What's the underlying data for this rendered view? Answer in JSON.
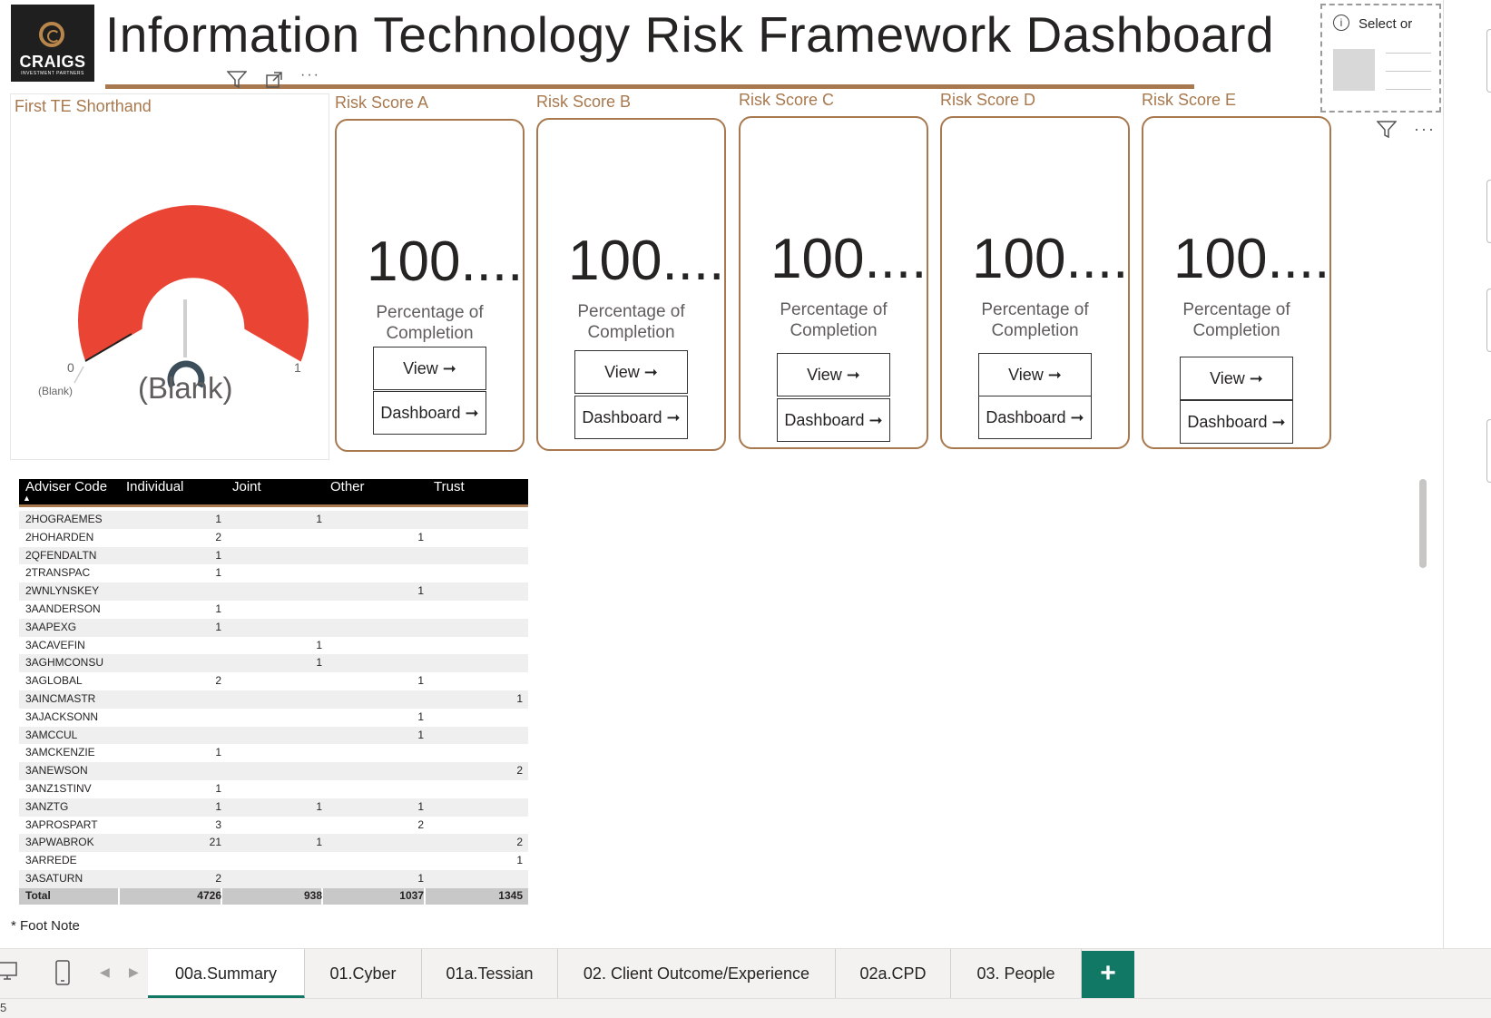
{
  "header": {
    "title": "Information Technology Risk Framework Dashboard",
    "logo": {
      "name": "CRAIGS",
      "sub": "INVESTMENT PARTNERS",
      "brand_color": "#a8794f"
    }
  },
  "slicer": {
    "label": "Select or"
  },
  "gauge": {
    "title": "First TE Shorthand",
    "min": "0",
    "max": "1",
    "target_label": "(Blank)",
    "value": "(Blank)",
    "fill_color": "#e94434"
  },
  "risk_cards": [
    {
      "title": "Risk Score A",
      "value": "100....",
      "caption": "Percentage of Completion",
      "view_label": "View ➞",
      "dashboard_label": "Dashboard ➞"
    },
    {
      "title": "Risk Score B",
      "value": "100....",
      "caption": "Percentage of Completion",
      "view_label": "View ➞",
      "dashboard_label": "Dashboard ➞"
    },
    {
      "title": "Risk Score C",
      "value": "100....",
      "caption": "Percentage of Completion",
      "view_label": "View ➞",
      "dashboard_label": "Dashboard ➞"
    },
    {
      "title": "Risk Score D",
      "value": "100....",
      "caption": "Percentage of Completion",
      "view_label": "View ➞",
      "dashboard_label": "Dashboard ➞"
    },
    {
      "title": "Risk Score E",
      "value": "100....",
      "caption": "Percentage of Completion",
      "view_label": "View ➞",
      "dashboard_label": "Dashboard ➞"
    }
  ],
  "table": {
    "columns": [
      "Adviser Code",
      "Individual",
      "Joint",
      "Other",
      "Trust"
    ],
    "rows": [
      [
        "2HOGRAEMES",
        "1",
        "1",
        "",
        ""
      ],
      [
        "2HOHARDEN",
        "2",
        "",
        "1",
        ""
      ],
      [
        "2QFENDALTN",
        "1",
        "",
        "",
        ""
      ],
      [
        "2TRANSPAC",
        "1",
        "",
        "",
        ""
      ],
      [
        "2WNLYNSKEY",
        "",
        "",
        "1",
        ""
      ],
      [
        "3AANDERSON",
        "1",
        "",
        "",
        ""
      ],
      [
        "3AAPEXG",
        "1",
        "",
        "",
        ""
      ],
      [
        "3ACAVEFIN",
        "",
        "1",
        "",
        ""
      ],
      [
        "3AGHMCONSU",
        "",
        "1",
        "",
        ""
      ],
      [
        "3AGLOBAL",
        "2",
        "",
        "1",
        ""
      ],
      [
        "3AINCMASTR",
        "",
        "",
        "",
        "1"
      ],
      [
        "3AJACKSONN",
        "",
        "",
        "1",
        ""
      ],
      [
        "3AMCCUL",
        "",
        "",
        "1",
        ""
      ],
      [
        "3AMCKENZIE",
        "1",
        "",
        "",
        ""
      ],
      [
        "3ANEWSON",
        "",
        "",
        "",
        "2"
      ],
      [
        "3ANZ1STINV",
        "1",
        "",
        "",
        ""
      ],
      [
        "3ANZTG",
        "1",
        "1",
        "1",
        ""
      ],
      [
        "3APROSPART",
        "3",
        "",
        "2",
        ""
      ],
      [
        "3APWABROK",
        "21",
        "1",
        "",
        "2"
      ],
      [
        "3ARREDE",
        "",
        "",
        "",
        "1"
      ],
      [
        "3ASATURN",
        "2",
        "",
        "1",
        ""
      ]
    ],
    "total": [
      "Total",
      "4726",
      "938",
      "1037",
      "1345"
    ]
  },
  "footnote": "* Foot Note",
  "tabs": [
    {
      "label": "00a.Summary",
      "active": true
    },
    {
      "label": "01.Cyber"
    },
    {
      "label": "01a.Tessian"
    },
    {
      "label": "02. Client Outcome/Experience"
    },
    {
      "label": "02a.CPD"
    },
    {
      "label": "03. People"
    }
  ],
  "add_tab_label": "+",
  "icons": {
    "visual_header": [
      "filter-icon",
      "focus-mode-icon",
      "more-options-icon"
    ],
    "nav": [
      "desktop-view-icon",
      "mobile-view-icon",
      "prev-page-icon",
      "next-page-icon"
    ]
  },
  "status_bar_text": "5"
}
